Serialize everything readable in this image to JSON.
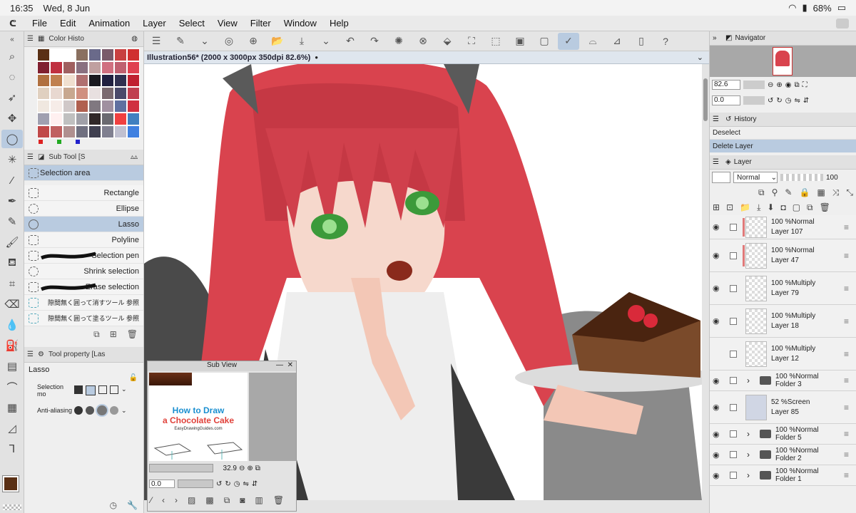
{
  "status_bar": {
    "time": "16:35",
    "date": "Wed, 8 Jun",
    "battery": "68%"
  },
  "menu": {
    "items": [
      "File",
      "Edit",
      "Animation",
      "Layer",
      "Select",
      "View",
      "Filter",
      "Window",
      "Help"
    ]
  },
  "panels": {
    "color_history": {
      "title": "Color Histo"
    },
    "sub_tool": {
      "title": "Sub Tool [S",
      "group": "Selection area",
      "items": [
        {
          "label": "Rectangle"
        },
        {
          "label": "Ellipse"
        },
        {
          "label": "Lasso"
        },
        {
          "label": "Polyline"
        },
        {
          "label": "Selection pen"
        },
        {
          "label": "Shrink selection"
        },
        {
          "label": "Erase selection"
        },
        {
          "label": "隙間無く囲って消すツール 参照"
        },
        {
          "label": "隙間無く囲って塗るツール 参照"
        }
      ]
    },
    "tool_property": {
      "title": "Tool property [Las",
      "tool_name": "Lasso",
      "selection_mode_label": "Selection mo",
      "anti_aliasing_label": "Anti-aliasing"
    }
  },
  "document": {
    "tab_title": "Illustration56* (2000 x 3000px 350dpi 82.6%)"
  },
  "sub_view": {
    "title": "Sub View",
    "preview_title_1": "How to Draw",
    "preview_title_2": "a Chocolate Cake",
    "preview_site": "EasyDrawingGuides.com",
    "zoom": "32.9",
    "rotation": "0.0"
  },
  "navigator": {
    "title": "Navigator",
    "zoom": "82.6",
    "rotation": "0.0"
  },
  "history": {
    "title": "History",
    "items": [
      "Deselect",
      "Delete Layer"
    ]
  },
  "layer_panel": {
    "title": "Layer",
    "blend_mode": "Normal",
    "opacity": "100",
    "layers": [
      {
        "blend": "100 %Normal",
        "name": "Layer 107"
      },
      {
        "blend": "100 %Normal",
        "name": "Layer 47"
      },
      {
        "blend": "100 %Multiply",
        "name": "Layer 79"
      },
      {
        "blend": "100 %Multiply",
        "name": "Layer 18"
      },
      {
        "blend": "100 %Multiply",
        "name": "Layer 12"
      },
      {
        "blend": "100 %Normal",
        "name": "Folder 3"
      },
      {
        "blend": "52 %Screen",
        "name": "Layer 85"
      },
      {
        "blend": "100 %Normal",
        "name": "Folder 5"
      },
      {
        "blend": "100 %Normal",
        "name": "Folder 2"
      },
      {
        "blend": "100 %Normal",
        "name": "Folder 1"
      }
    ]
  },
  "colors": {
    "accent": "#b9cbe0",
    "main_color": "#5a3015",
    "sub_color": "#3a2010"
  }
}
